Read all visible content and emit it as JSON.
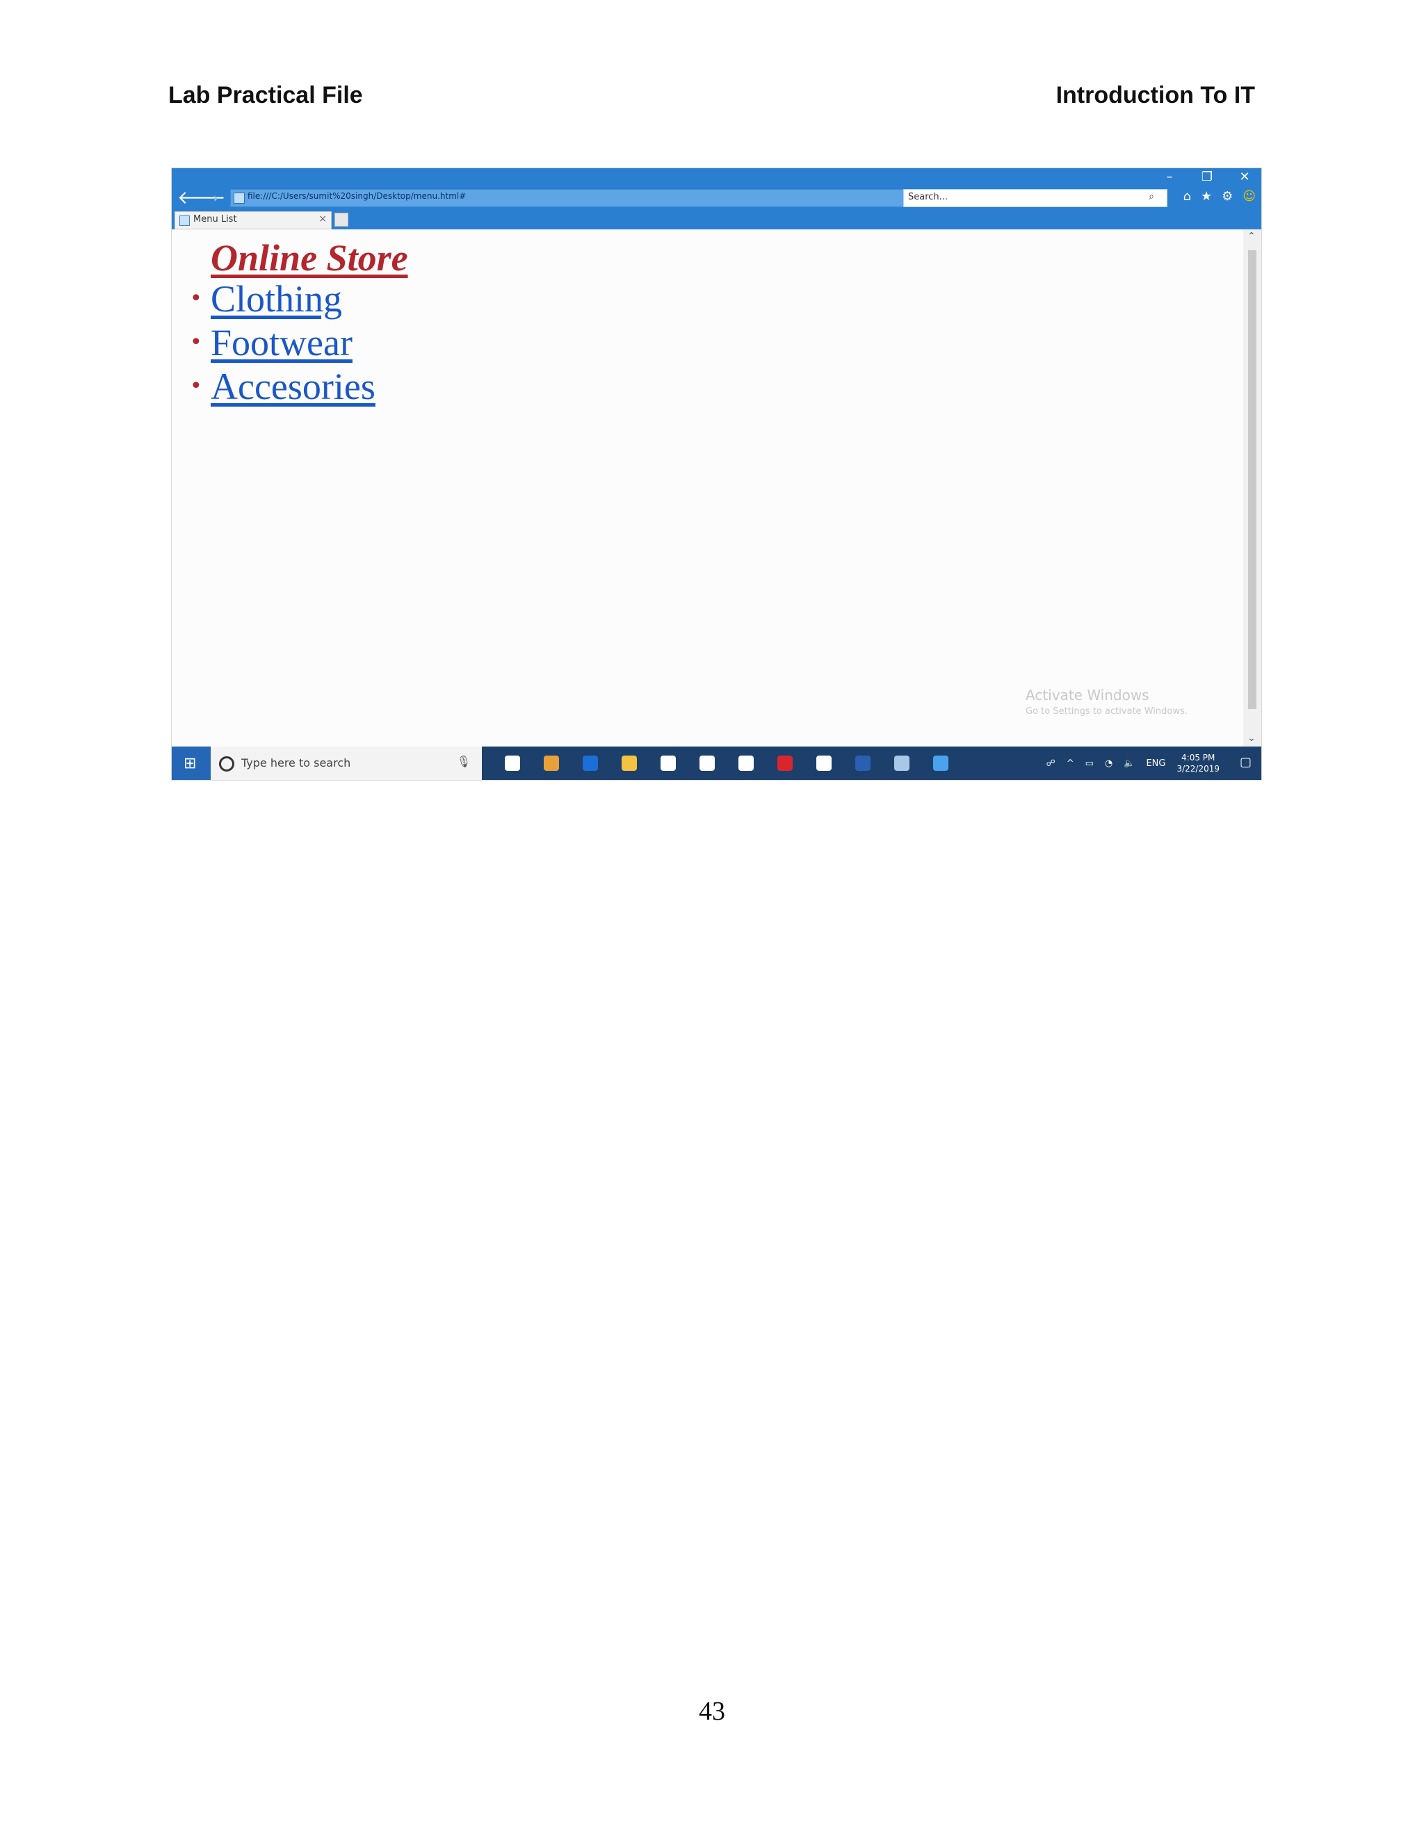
{
  "doc": {
    "header_left": "Lab Practical File",
    "header_right": "Introduction To IT",
    "page_number": "43"
  },
  "browser": {
    "address": "file:///C:/Users/sumit%20singh/Desktop/menu.html#",
    "search_placeholder": "Search...",
    "tab_label": "Menu List",
    "window_controls": {
      "minimize": "–",
      "restore": "❐",
      "close": "✕"
    },
    "icons": [
      "home-icon",
      "favorites-star-icon",
      "settings-gear-icon",
      "feedback-smiley-icon"
    ]
  },
  "webpage": {
    "title": "Online Store",
    "menu": [
      {
        "label": "Clothing"
      },
      {
        "label": "Footwear"
      },
      {
        "label": "Accesories"
      }
    ]
  },
  "watermark": {
    "title": "Activate Windows",
    "subtitle": "Go to Settings to activate Windows."
  },
  "taskbar": {
    "search_placeholder": "Type here to search",
    "apps": [
      {
        "name": "task-view-icon",
        "color": "#ffffff"
      },
      {
        "name": "chrome-icon",
        "color": "#e8a13a"
      },
      {
        "name": "edge-icon",
        "color": "#1b6fd6"
      },
      {
        "name": "file-explorer-icon",
        "color": "#f5c242"
      },
      {
        "name": "store-icon",
        "color": "#ffffff"
      },
      {
        "name": "settings-icon",
        "color": "#ffffff"
      },
      {
        "name": "mail-icon",
        "color": "#ffffff"
      },
      {
        "name": "opera-icon",
        "color": "#d9262d"
      },
      {
        "name": "facebook-icon",
        "color": "#ffffff"
      },
      {
        "name": "word-icon",
        "color": "#2b5fb4"
      },
      {
        "name": "notepad-icon",
        "color": "#a9c7e6"
      },
      {
        "name": "internet-explorer-icon",
        "color": "#4aa3ef"
      }
    ],
    "lang": "ENG",
    "time": "4:05 PM",
    "date": "3/22/2019"
  },
  "colors": {
    "title_red": "#b3262d",
    "link_blue": "#1a57c7",
    "ie_blue": "#2b7fd0",
    "taskbar": "#1d3f6b"
  }
}
